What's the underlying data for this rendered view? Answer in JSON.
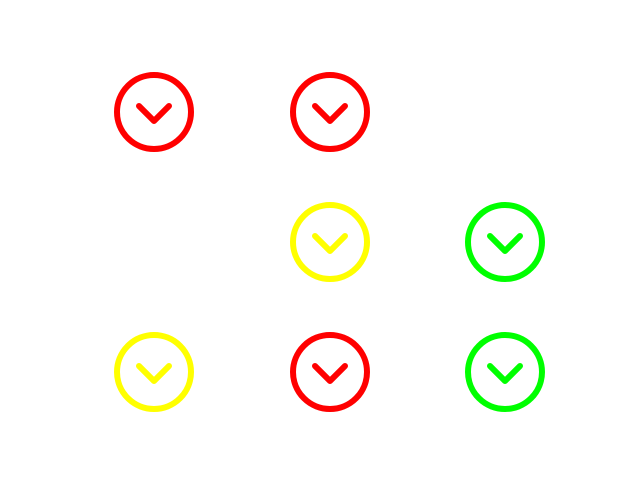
{
  "colors": {
    "red": "#ff0000",
    "yellow": "#ffff00",
    "green": "#00ff00",
    "background": "#ffffff"
  },
  "icon_type": "chevron-down-circle-icon",
  "grid": [
    [
      "red",
      "red",
      null
    ],
    [
      null,
      "yellow",
      "green"
    ],
    [
      "yellow",
      "red",
      "green"
    ]
  ]
}
